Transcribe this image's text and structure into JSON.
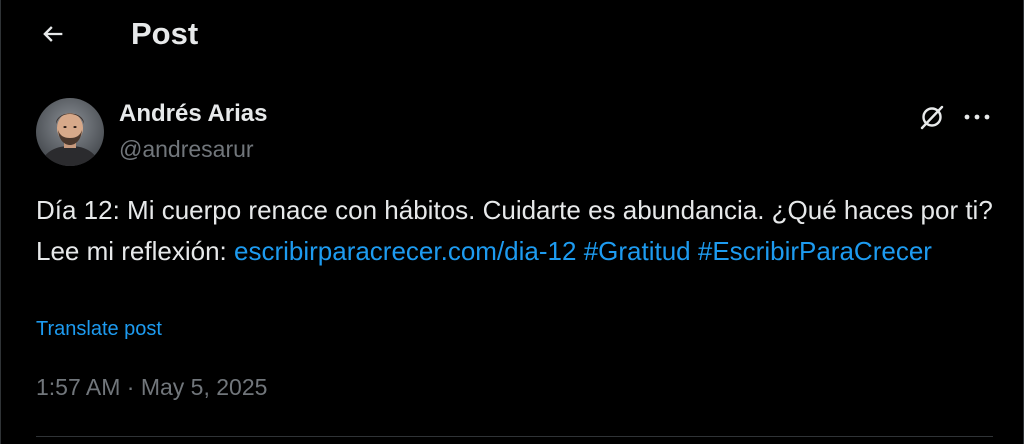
{
  "header": {
    "title": "Post",
    "back_icon": "arrow-left-icon"
  },
  "author": {
    "name": "Andrés Arias",
    "handle": "@andresarur",
    "avatar_icon": "profile-photo"
  },
  "actions": {
    "grok_icon": "grok-icon",
    "more_icon": "more-horizontal-icon"
  },
  "post": {
    "text_before": "Día 12: Mi cuerpo renace con hábitos. Cuidarte es abundancia. ¿Qué haces por ti? Lee mi reflexión: ",
    "link": "escribirparacrecer.com/dia-12",
    "hashtag_1": "#Gratitud",
    "hashtag_2": "#EscribirParaCrecer",
    "translate_label": "Translate post"
  },
  "meta": {
    "time": "1:57 AM",
    "separator": " · ",
    "date": "May 5, 2025"
  },
  "colors": {
    "background": "#000000",
    "text": "#e7e9ea",
    "secondary": "#71767b",
    "accent": "#1d9bf0",
    "border": "#2f3336"
  }
}
